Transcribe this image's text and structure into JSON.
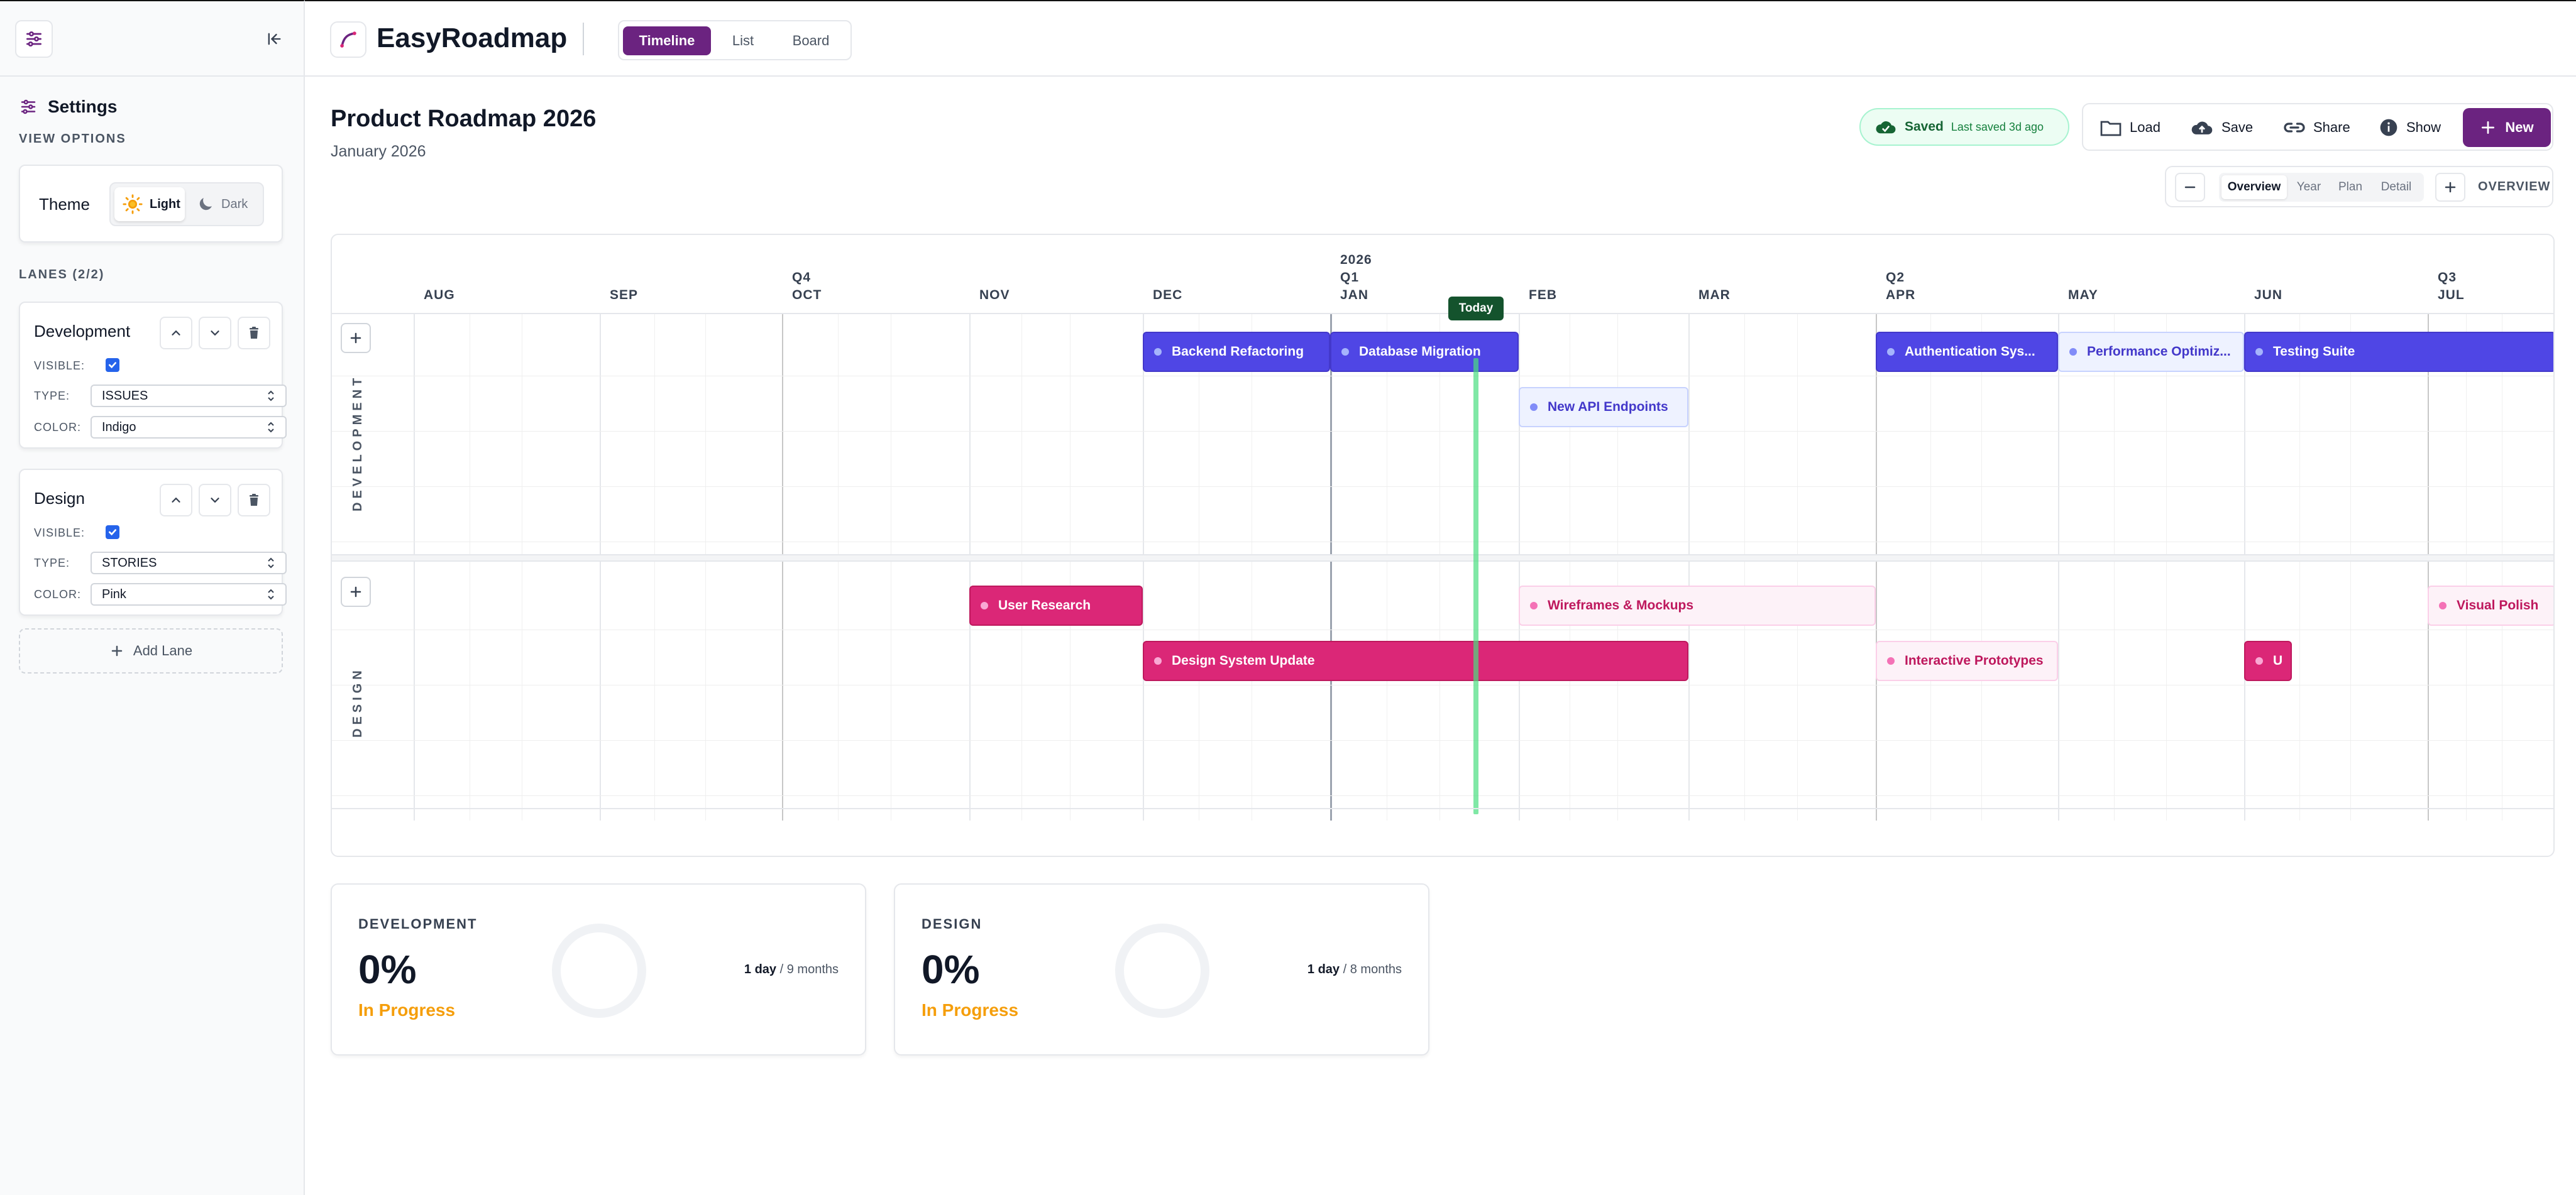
{
  "sidebar": {
    "title": "Settings",
    "view_options": "VIEW OPTIONS",
    "theme_label": "Theme",
    "theme_light": "Light",
    "theme_dark": "Dark",
    "lanes_header": "LANES (2/2)",
    "visible_label": "VISIBLE:",
    "type_label": "TYPE:",
    "color_label": "COLOR:",
    "lanes": [
      {
        "name": "Development",
        "visible": true,
        "type": "ISSUES",
        "color": "Indigo"
      },
      {
        "name": "Design",
        "visible": true,
        "type": "STORIES",
        "color": "Pink"
      }
    ],
    "add_lane": "Add Lane"
  },
  "topbar": {
    "app_title": "EasyRoadmap",
    "tabs": [
      {
        "label": "Timeline"
      },
      {
        "label": "List"
      },
      {
        "label": "Board"
      }
    ],
    "active_tab": "Timeline"
  },
  "header": {
    "title": "Product Roadmap 2026",
    "subtitle": "January 2026",
    "saved": "Saved",
    "last_saved": "Last saved 3d ago",
    "actions": {
      "load": "Load",
      "save": "Save",
      "share": "Share",
      "show": "Show",
      "new": "New"
    },
    "zoom_levels": [
      "Overview",
      "Year",
      "Plan",
      "Detail"
    ],
    "zoom_active": "Overview",
    "zoom_label": "OVERVIEW"
  },
  "timeline": {
    "months": [
      "AUG",
      "SEP",
      "OCT",
      "NOV",
      "DEC",
      "JAN",
      "FEB",
      "MAR",
      "APR",
      "MAY",
      "JUN",
      "JUL"
    ],
    "quarters": [
      {
        "label": "Q4",
        "month": "OCT"
      },
      {
        "label": "Q1",
        "month": "JAN"
      },
      {
        "label": "Q2",
        "month": "APR"
      },
      {
        "label": "Q3",
        "month": "JUL"
      }
    ],
    "year_marker": {
      "label": "2026",
      "month": "JAN"
    },
    "today_label": "Today",
    "today": "January 2026",
    "lanes": [
      {
        "name": "DEVELOPMENT",
        "color": "#4f46e5",
        "items": [
          {
            "title": "Backend Refactoring",
            "row": 0,
            "start": "DEC",
            "end": "JAN",
            "style": "solid"
          },
          {
            "title": "Database Migration",
            "row": 0,
            "start": "JAN",
            "end": "JAN",
            "style": "solid"
          },
          {
            "title": "New API Endpoints",
            "row": 1,
            "start": "FEB",
            "end": "FEB",
            "style": "light"
          },
          {
            "title": "Authentication Sys...",
            "row": 0,
            "start": "APR",
            "end": "APR",
            "style": "solid"
          },
          {
            "title": "Performance Optimiz...",
            "row": 0,
            "start": "MAY",
            "end": "MAY",
            "style": "light"
          },
          {
            "title": "Testing Suite",
            "row": 0,
            "start": "JUN",
            "end": "JUL",
            "style": "solid"
          }
        ]
      },
      {
        "name": "DESIGN",
        "color": "#db2777",
        "items": [
          {
            "title": "User Research",
            "row": 0,
            "start": "NOV",
            "end": "NOV",
            "style": "solid"
          },
          {
            "title": "Wireframes & Mockups",
            "row": 0,
            "start": "FEB",
            "end": "MAR",
            "style": "light"
          },
          {
            "title": "Visual Polish",
            "row": 0,
            "start": "JUL",
            "end": "JUL",
            "style": "light"
          },
          {
            "title": "Design System Update",
            "row": 1,
            "start": "DEC",
            "end": "FEB",
            "style": "solid"
          },
          {
            "title": "Interactive Prototypes",
            "row": 1,
            "start": "APR",
            "end": "APR",
            "style": "light"
          },
          {
            "title": "U",
            "row": 1,
            "start": "JUN",
            "end": "JUN",
            "style": "solid"
          }
        ]
      }
    ]
  },
  "stats": [
    {
      "name": "DEVELOPMENT",
      "percent": "0%",
      "status": "In Progress",
      "duration_bold": "1 day",
      "duration_rest": " / 9 months"
    },
    {
      "name": "DESIGN",
      "percent": "0%",
      "status": "In Progress",
      "duration_bold": "1 day",
      "duration_rest": " / 8 months"
    }
  ],
  "colors": {
    "brand": "#6b2380",
    "indigo": "#4f46e5",
    "pink": "#db2777",
    "today": "#4ade80",
    "in_progress": "#f59e0b"
  }
}
